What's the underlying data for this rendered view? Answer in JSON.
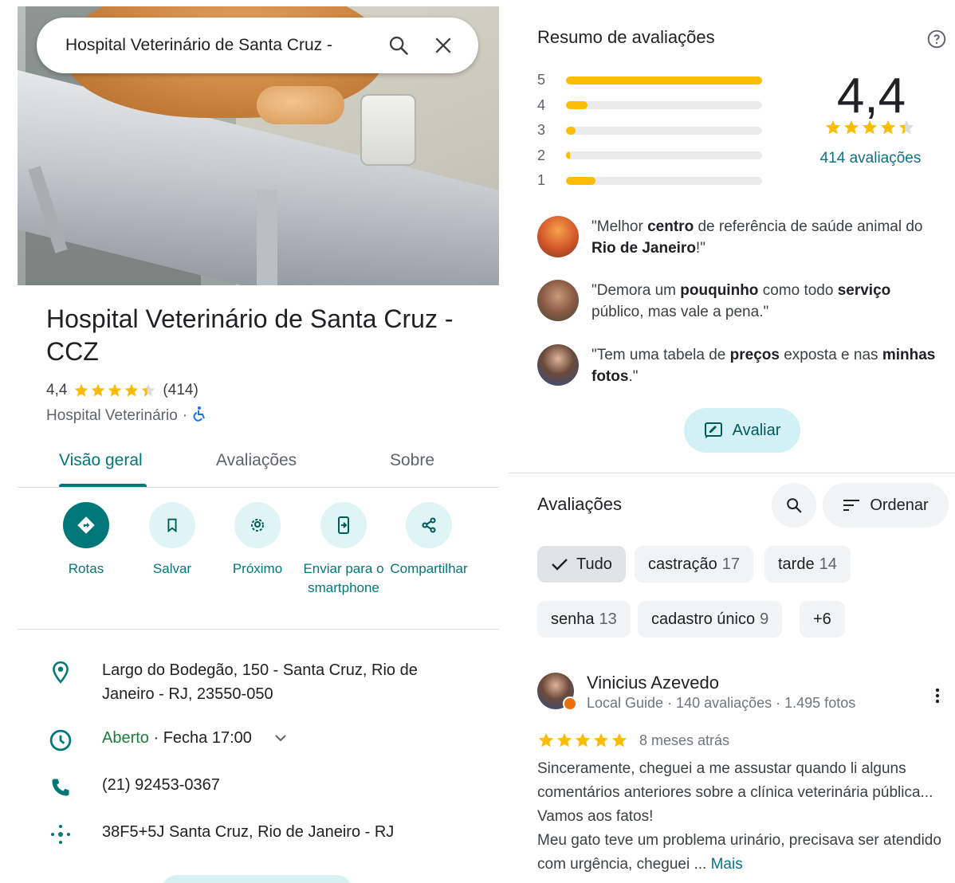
{
  "search": {
    "query": "Hospital Veterinário de Santa Cruz -"
  },
  "place": {
    "title": "Hospital Veterinário de Santa Cruz - CCZ",
    "rating": "4,4",
    "rating_value": 4.4,
    "review_count_paren": "(414)",
    "category": "Hospital Veterinário",
    "separator": "·"
  },
  "tabs": [
    {
      "label": "Visão geral",
      "active": true
    },
    {
      "label": "Avaliações",
      "active": false
    },
    {
      "label": "Sobre",
      "active": false
    }
  ],
  "actions": [
    {
      "label": "Rotas",
      "icon": "directions-icon"
    },
    {
      "label": "Salvar",
      "icon": "bookmark-icon"
    },
    {
      "label": "Próximo",
      "icon": "nearby-icon"
    },
    {
      "label": "Enviar para o smartphone",
      "icon": "send-to-phone-icon"
    },
    {
      "label": "Compartilhar",
      "icon": "share-icon"
    }
  ],
  "info": {
    "address": "Largo do Bodegão, 150 - Santa Cruz, Rio de Janeiro - RJ, 23550-050",
    "hours_status": "Aberto",
    "hours_sep": " · ",
    "hours_close": "Fecha 17:00",
    "phone": "(21) 92453-0367",
    "plus_code": "38F5+5J Santa Cruz, Rio de Janeiro - RJ"
  },
  "summary": {
    "title": "Resumo de avaliações",
    "score": "4,4",
    "total": "414 avaliações",
    "distribution": [
      {
        "stars": "5",
        "fraction": 1.0
      },
      {
        "stars": "4",
        "fraction": 0.11
      },
      {
        "stars": "3",
        "fraction": 0.05
      },
      {
        "stars": "2",
        "fraction": 0.02
      },
      {
        "stars": "1",
        "fraction": 0.15
      }
    ],
    "snippets": [
      {
        "parts": [
          "\"Melhor ",
          "centro",
          " de referência de saúde animal do ",
          "Rio de Janeiro",
          "!\""
        ]
      },
      {
        "parts": [
          "\"Demora um ",
          "pouquinho",
          " como todo ",
          "serviço",
          " público, mas vale a pena.\""
        ]
      },
      {
        "parts": [
          "\"Tem uma tabela de ",
          "preços",
          " exposta e nas ",
          "minhas fotos",
          ".\""
        ]
      }
    ],
    "rate_button": "Avaliar"
  },
  "reviews": {
    "title": "Avaliações",
    "sort_label": "Ordenar",
    "chips": [
      {
        "label": "Tudo",
        "count": "",
        "selected": true
      },
      {
        "label": "castração",
        "count": "17",
        "selected": false
      },
      {
        "label": "tarde",
        "count": "14",
        "selected": false
      },
      {
        "label": "senha",
        "count": "13",
        "selected": false
      },
      {
        "label": "cadastro único",
        "count": "9",
        "selected": false
      },
      {
        "label": "+6",
        "count": "",
        "selected": false
      }
    ],
    "review": {
      "author": "Vinicius Azevedo",
      "meta": "Local Guide · 140 avaliações · 1.495 fotos",
      "stars": 5,
      "ago": "8 meses atrás",
      "text": "Sinceramente, cheguei a me assustar quando li alguns comentários anteriores sobre a clínica veterinária pública... Vamos aos fatos!\nMeu gato teve um problema urinário, precisava ser atendido com urgência, cheguei ...",
      "more": "Mais"
    }
  },
  "colors": {
    "accent": "#00787a",
    "star": "#fbbc04",
    "open": "#188038"
  }
}
